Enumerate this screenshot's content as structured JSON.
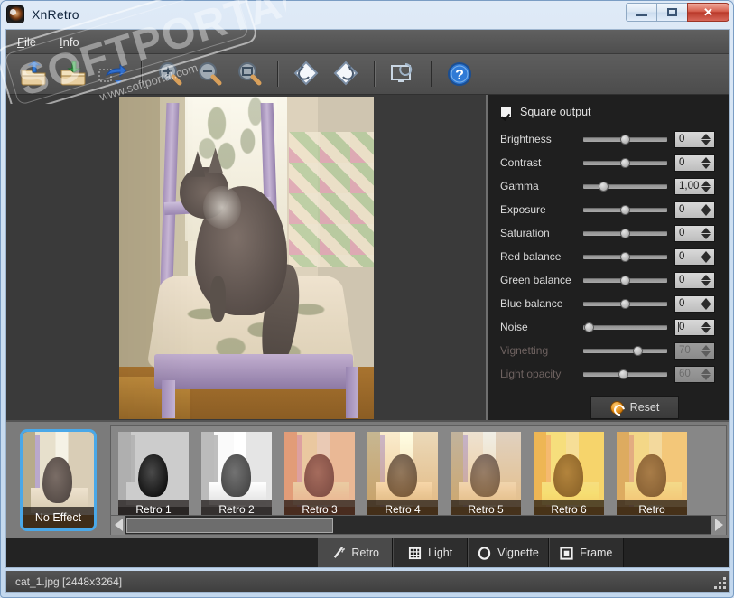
{
  "window": {
    "title": "XnRetro",
    "icon": "app-logo-icon",
    "buttons": {
      "minimize": "—",
      "maximize": "□",
      "close": "✕"
    }
  },
  "menu": {
    "items": [
      {
        "label": "File"
      },
      {
        "label": "Info"
      }
    ]
  },
  "toolbar": {
    "items": [
      {
        "name": "open-file",
        "icon": "folder-up-icon"
      },
      {
        "name": "save-file",
        "icon": "folder-down-icon"
      },
      {
        "name": "share",
        "icon": "share-arrow-icon"
      },
      {
        "name": "zoom-in",
        "icon": "magnifier-plus-icon"
      },
      {
        "name": "zoom-out",
        "icon": "magnifier-minus-icon"
      },
      {
        "name": "zoom-fit",
        "icon": "magnifier-fit-icon"
      },
      {
        "name": "rotate-left",
        "icon": "rotate-left-icon"
      },
      {
        "name": "rotate-right",
        "icon": "rotate-right-icon"
      },
      {
        "name": "reset-view",
        "icon": "screen-reset-icon"
      },
      {
        "name": "help",
        "icon": "help-question-icon"
      }
    ]
  },
  "watermark": {
    "text": "SOFTPORTAL",
    "url": "www.softportal.com"
  },
  "adjustments": {
    "square_output": {
      "label": "Square output",
      "checked": true
    },
    "sliders": [
      {
        "label": "Brightness",
        "value": "0",
        "pos": 50,
        "enabled": true
      },
      {
        "label": "Contrast",
        "value": "0",
        "pos": 50,
        "enabled": true
      },
      {
        "label": "Gamma",
        "value": "1,00",
        "pos": 22,
        "enabled": true
      },
      {
        "label": "Exposure",
        "value": "0",
        "pos": 50,
        "enabled": true
      },
      {
        "label": "Saturation",
        "value": "0",
        "pos": 50,
        "enabled": true
      },
      {
        "label": "Red balance",
        "value": "0",
        "pos": 50,
        "enabled": true
      },
      {
        "label": "Green balance",
        "value": "0",
        "pos": 50,
        "enabled": true
      },
      {
        "label": "Blue balance",
        "value": "0",
        "pos": 50,
        "enabled": true
      },
      {
        "label": "Noise",
        "value": "0",
        "pos": 3,
        "enabled": true
      },
      {
        "label": "Vignetting",
        "value": "70",
        "pos": 64,
        "enabled": false
      },
      {
        "label": "Light opacity",
        "value": "60",
        "pos": 46,
        "enabled": false
      }
    ],
    "reset_button": {
      "label": "Reset",
      "icon": "reset-circle-icon"
    }
  },
  "effects": {
    "selected": "No Effect",
    "items": [
      {
        "label": "No Effect",
        "selected": true
      },
      {
        "label": "Retro 1",
        "selected": false
      },
      {
        "label": "Retro 2",
        "selected": false
      },
      {
        "label": "Retro 3",
        "selected": false
      },
      {
        "label": "Retro 4",
        "selected": false
      },
      {
        "label": "Retro 5",
        "selected": false
      },
      {
        "label": "Retro 6",
        "selected": false
      },
      {
        "label": "Retro",
        "selected": false
      }
    ]
  },
  "tabs": [
    {
      "label": "Retro",
      "icon": "magic-wand-icon",
      "active": true
    },
    {
      "label": "Light",
      "icon": "grid-dots-icon",
      "active": false
    },
    {
      "label": "Vignette",
      "icon": "ellipse-icon",
      "active": false
    },
    {
      "label": "Frame",
      "icon": "square-frame-icon",
      "active": false
    }
  ],
  "status": {
    "text": "cat_1.jpg [2448x3264]"
  },
  "colors": {
    "accent_selection": "#4aa8e8",
    "panel_bg": "#1f1f1f",
    "canvas_bg": "#3a3a3a",
    "strip_bg": "#878787",
    "close_button": "#b9392a"
  }
}
